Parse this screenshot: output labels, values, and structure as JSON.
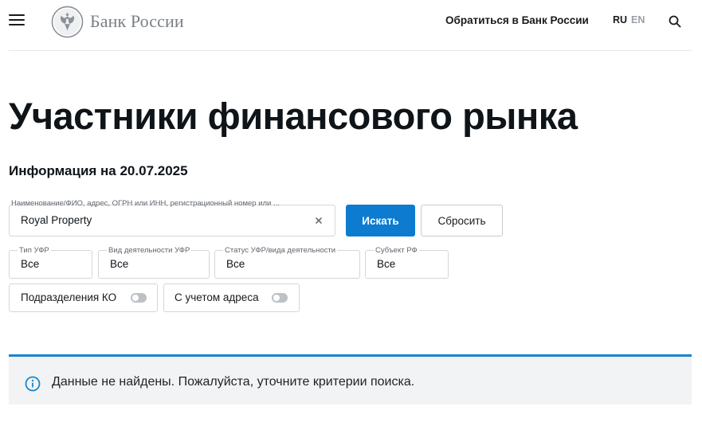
{
  "header": {
    "logo_text": "Банк России",
    "contact_link": "Обратиться в Банк России",
    "lang_ru": "RU",
    "lang_en": "EN"
  },
  "page": {
    "title": "Участники финансового рынка",
    "subtitle": "Информация на 20.07.2025"
  },
  "search": {
    "label": "Наименование/ФИО, адрес, ОГРН или ИНН, регистрационный номер или ...",
    "value": "Royal Property",
    "search_button": "Искать",
    "reset_button": "Сбросить"
  },
  "filters": [
    {
      "label": "Тип УФР",
      "value": "Все"
    },
    {
      "label": "Вид деятельности УФР",
      "value": "Все"
    },
    {
      "label": "Статус УФР/вида деятельности",
      "value": "Все"
    },
    {
      "label": "Субъект РФ",
      "value": "Все"
    }
  ],
  "toggles": [
    {
      "label": "Подразделения КО",
      "on": false
    },
    {
      "label": "С учетом адреса",
      "on": false
    }
  ],
  "alert": {
    "text": "Данные не найдены. Пожалуйста, уточните критерии поиска.",
    "icon": "info-icon",
    "accent_color": "#1a85cc"
  },
  "colors": {
    "primary_button": "#0c7bd0"
  }
}
